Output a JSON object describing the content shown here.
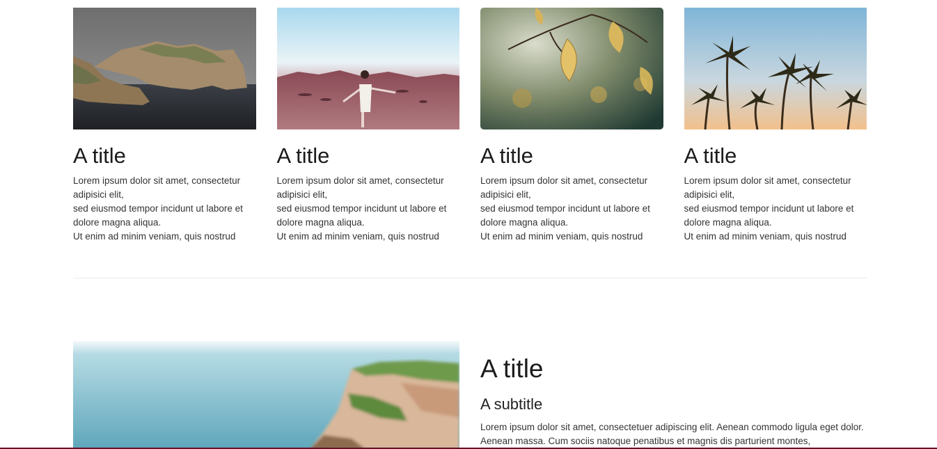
{
  "cards": [
    {
      "title": "A title",
      "text": "Lorem ipsum dolor sit amet, consectetur adipisici elit,\nsed eiusmod tempor incidunt ut labore et dolore magna aliqua.\nUt enim ad minim veniam, quis nostrud",
      "image": "coastal-cliffs-photo"
    },
    {
      "title": "A title",
      "text": "Lorem ipsum dolor sit amet, consectetur adipisici elit,\nsed eiusmod tempor incidunt ut labore et dolore magna aliqua.\nUt enim ad minim veniam, quis nostrud",
      "image": "woman-in-desert-photo"
    },
    {
      "title": "A title",
      "text": "Lorem ipsum dolor sit amet, consectetur adipisici elit,\nsed eiusmod tempor incidunt ut labore et dolore magna aliqua.\nUt enim ad minim veniam, quis nostrud",
      "image": "autumn-leaves-photo"
    },
    {
      "title": "A title",
      "text": "Lorem ipsum dolor sit amet, consectetur adipisici elit,\nsed eiusmod tempor incidunt ut labore et dolore magna aliqua.\nUt enim ad minim veniam, quis nostrud",
      "image": "palm-trees-photo"
    }
  ],
  "feature": {
    "title": "A title",
    "subtitle": "A subtitle",
    "body": "Lorem ipsum dolor sit amet, consectetuer adipiscing elit. Aenean commodo ligula eget dolor. Aenean massa. Cum sociis natoque penatibus et magnis dis parturient montes,",
    "image": "sea-cliff-photo"
  },
  "colors": {
    "accent_bar": "#6b0f22",
    "divider": "#ececec"
  }
}
